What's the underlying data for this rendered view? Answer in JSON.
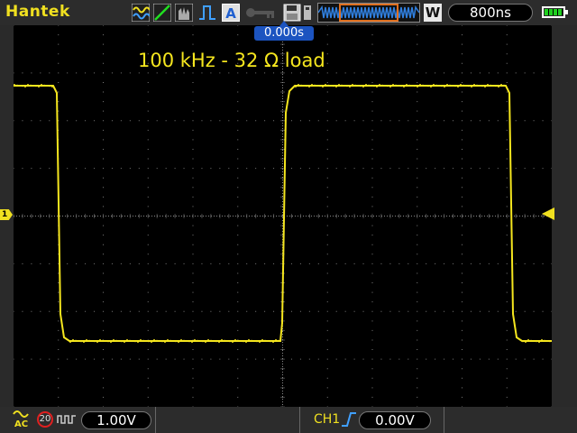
{
  "header": {
    "brand": "Hantek",
    "menu_mode_label": "A",
    "window_label": "W",
    "timebase": "800ns"
  },
  "display": {
    "trigger_position": "0.000s",
    "annotation": "100 kHz - 32 Ω load",
    "channel_marker": "1",
    "trace_color": "#f5e61e"
  },
  "footer": {
    "coupling": "AC",
    "bandwidth_limit": "20",
    "vertical_scale": "1.00V",
    "trigger_source": "CH1",
    "trigger_level": "0.00V"
  }
}
